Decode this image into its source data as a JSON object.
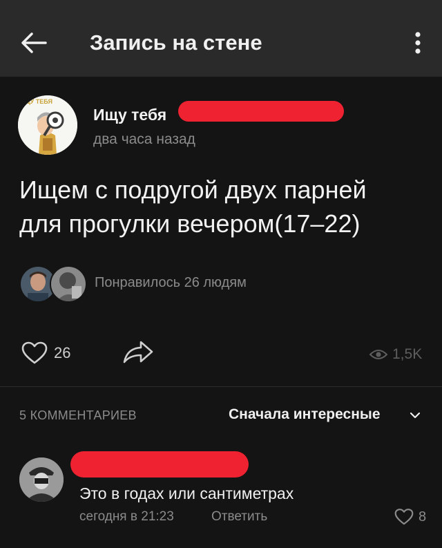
{
  "header": {
    "title": "Запись на стене",
    "back_icon": "arrow-left-icon",
    "menu_icon": "more-vertical-icon"
  },
  "post": {
    "author": {
      "name": "Ищу тебя",
      "avatar_text": "ИЩУ ТЕБЯ",
      "name_redacted": true
    },
    "time": "два часа назад",
    "text_lines": [
      "Ищем с подругой двух парней",
      "для прогулки вечером(17–22)"
    ],
    "likers_text": "Понравилось 26 людям",
    "like_count": "26",
    "views_count": "1,5K"
  },
  "comments": {
    "count_label": "5 КОММЕНТАРИЕВ",
    "sort_label": "Сначала интересные",
    "items": [
      {
        "author_redacted": true,
        "text": "Это в годах или сантиметрах",
        "time": "сегодня в 21:23",
        "reply_label": "Ответить",
        "like_count": "8"
      }
    ]
  },
  "colors": {
    "background": "#141414",
    "header_bg": "#2a2a2a",
    "text_primary": "#f2f2f2",
    "text_secondary": "#8b8b8b",
    "redaction": "#ee2230"
  }
}
